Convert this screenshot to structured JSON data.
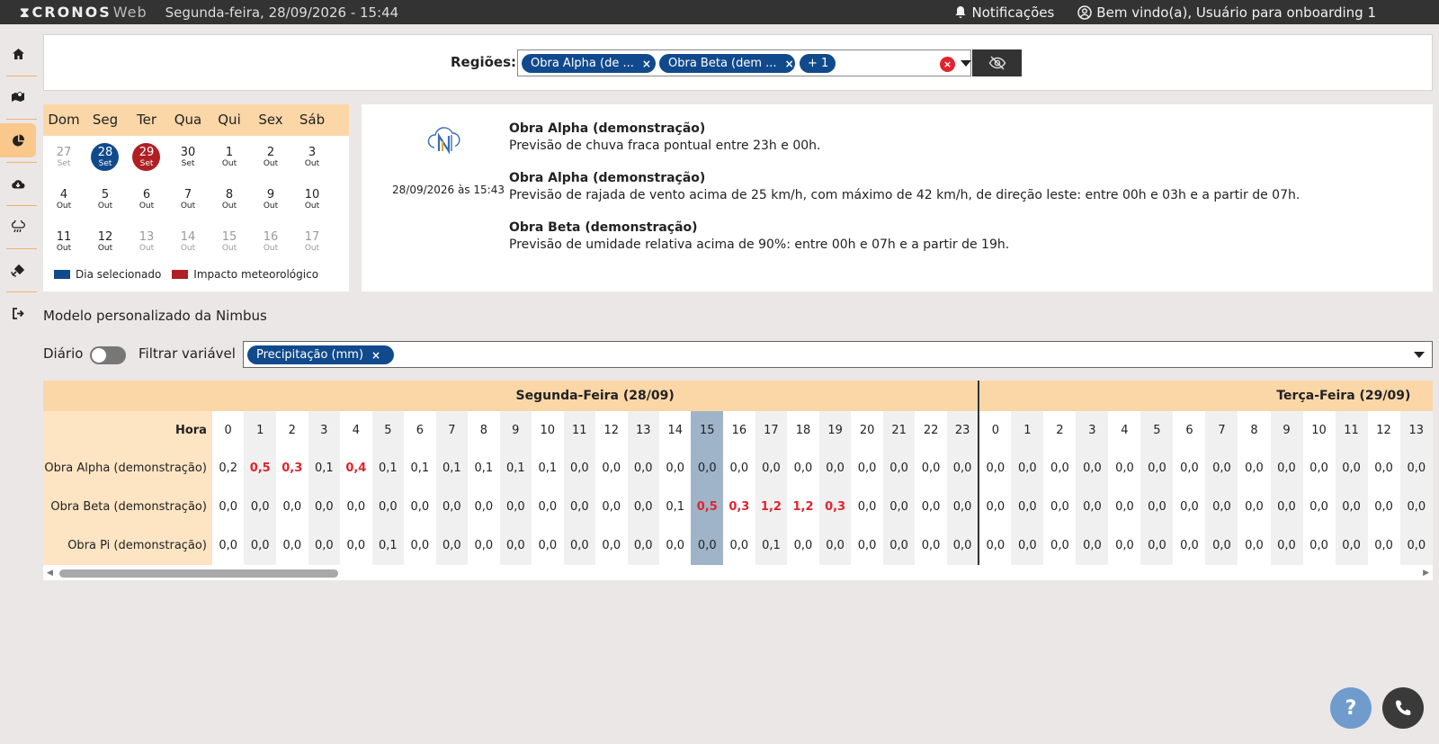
{
  "app": {
    "logo_main": "CRONOS",
    "logo_sub": "Web",
    "datetime": "Segunda-feira, 28/09/2026 - 15:44",
    "notifications": "Notificações",
    "welcome": "Bem vindo(a), Usuário para onboarding 1"
  },
  "sidebar": {
    "icons": [
      "home-icon",
      "map-icon",
      "pie-chart-icon",
      "cloud-download-icon",
      "cloud-rain-icon",
      "satellite-icon",
      "logout-icon"
    ]
  },
  "regions": {
    "label": "Regiões:",
    "chips": [
      "Obra Alpha (de ...",
      "Obra Beta (dem ...",
      "+ 1"
    ],
    "chip_close": "×",
    "clear": "×"
  },
  "calendar": {
    "weekdays": [
      "Dom",
      "Seg",
      "Ter",
      "Qua",
      "Qui",
      "Sex",
      "Sáb"
    ],
    "weeks": [
      [
        {
          "d": "27",
          "m": "Set",
          "s": "muted"
        },
        {
          "d": "28",
          "m": "Set",
          "s": "sel"
        },
        {
          "d": "29",
          "m": "Set",
          "s": "imp"
        },
        {
          "d": "30",
          "m": "Set",
          "s": ""
        },
        {
          "d": "1",
          "m": "Out",
          "s": ""
        },
        {
          "d": "2",
          "m": "Out",
          "s": ""
        },
        {
          "d": "3",
          "m": "Out",
          "s": ""
        }
      ],
      [
        {
          "d": "4",
          "m": "Out",
          "s": ""
        },
        {
          "d": "5",
          "m": "Out",
          "s": ""
        },
        {
          "d": "6",
          "m": "Out",
          "s": ""
        },
        {
          "d": "7",
          "m": "Out",
          "s": ""
        },
        {
          "d": "8",
          "m": "Out",
          "s": ""
        },
        {
          "d": "9",
          "m": "Out",
          "s": ""
        },
        {
          "d": "10",
          "m": "Out",
          "s": ""
        }
      ],
      [
        {
          "d": "11",
          "m": "Out",
          "s": ""
        },
        {
          "d": "12",
          "m": "Out",
          "s": ""
        },
        {
          "d": "13",
          "m": "Out",
          "s": "muted"
        },
        {
          "d": "14",
          "m": "Out",
          "s": "muted"
        },
        {
          "d": "15",
          "m": "Out",
          "s": "muted"
        },
        {
          "d": "16",
          "m": "Out",
          "s": "muted"
        },
        {
          "d": "17",
          "m": "Out",
          "s": "muted"
        }
      ]
    ],
    "legend_selected": "Dia selecionado",
    "legend_impact": "Impacto meteorológico",
    "color_selected": "#114a8c",
    "color_impact": "#b01f24"
  },
  "alerts": {
    "timestamp": "28/09/2026 às 15:43",
    "items": [
      {
        "title": "Obra Alpha (demonstração)",
        "body": "Previsão de chuva fraca pontual entre 23h e 00h."
      },
      {
        "title": "Obra Alpha (demonstração)",
        "body": "Previsão de rajada de vento acima de 25 km/h, com máximo de 42 km/h, de direção leste: entre 00h e 03h e a partir de 07h."
      },
      {
        "title": "Obra Beta (demonstração)",
        "body": "Previsão de umidade relativa acima de 90%: entre 00h e 07h e a partir de 19h."
      }
    ]
  },
  "model": {
    "title": "Modelo personalizado da Nimbus",
    "daily_label": "Diário",
    "filter_label": "Filtrar variável",
    "filter_chip": "Precipitação (mm)",
    "chip_close": "×"
  },
  "table": {
    "day1": "Segunda-Feira (28/09)",
    "day2": "Terça-Feira (29/09)",
    "hour_label": "Hora",
    "hours_day1": [
      "0",
      "1",
      "2",
      "3",
      "4",
      "5",
      "6",
      "7",
      "8",
      "9",
      "10",
      "11",
      "12",
      "13",
      "14",
      "15",
      "16",
      "17",
      "18",
      "19",
      "20",
      "21",
      "22",
      "23"
    ],
    "hours_day2": [
      "0",
      "1",
      "2",
      "3",
      "4",
      "5",
      "6",
      "7",
      "8",
      "9",
      "10",
      "11",
      "12",
      "13"
    ],
    "highlight_hour_index": 15,
    "rows": [
      {
        "name": "Obra Alpha (demonstração)",
        "day1": [
          "0,2",
          "0,5",
          "0,3",
          "0,1",
          "0,4",
          "0,1",
          "0,1",
          "0,1",
          "0,1",
          "0,1",
          "0,1",
          "0,0",
          "0,0",
          "0,0",
          "0,0",
          "0,0",
          "0,0",
          "0,0",
          "0,0",
          "0,0",
          "0,0",
          "0,0",
          "0,0",
          "0,0"
        ],
        "day1_alert": [
          1,
          2,
          4
        ],
        "day2": [
          "0,0",
          "0,0",
          "0,0",
          "0,0",
          "0,0",
          "0,0",
          "0,0",
          "0,0",
          "0,0",
          "0,0",
          "0,0",
          "0,0",
          "0,0",
          "0,0"
        ]
      },
      {
        "name": "Obra Beta (demonstração)",
        "day1": [
          "0,0",
          "0,0",
          "0,0",
          "0,0",
          "0,0",
          "0,0",
          "0,0",
          "0,0",
          "0,0",
          "0,0",
          "0,0",
          "0,0",
          "0,0",
          "0,0",
          "0,1",
          "0,5",
          "0,3",
          "1,2",
          "1,2",
          "0,3",
          "0,0",
          "0,0",
          "0,0",
          "0,0"
        ],
        "day1_alert": [
          15,
          16,
          17,
          18,
          19
        ],
        "day2": [
          "0,0",
          "0,0",
          "0,0",
          "0,0",
          "0,0",
          "0,0",
          "0,0",
          "0,0",
          "0,0",
          "0,0",
          "0,0",
          "0,0",
          "0,0",
          "0,0"
        ]
      },
      {
        "name": "Obra Pi (demonstração)",
        "day1": [
          "0,0",
          "0,0",
          "0,0",
          "0,0",
          "0,0",
          "0,1",
          "0,0",
          "0,0",
          "0,0",
          "0,0",
          "0,0",
          "0,0",
          "0,0",
          "0,0",
          "0,0",
          "0,0",
          "0,0",
          "0,1",
          "0,0",
          "0,0",
          "0,0",
          "0,0",
          "0,0",
          "0,0"
        ],
        "day1_alert": [],
        "day2": [
          "0,0",
          "0,0",
          "0,0",
          "0,0",
          "0,0",
          "0,0",
          "0,0",
          "0,0",
          "0,0",
          "0,0",
          "0,0",
          "0,0",
          "0,0",
          "0,0"
        ]
      }
    ]
  },
  "fabs": {
    "help": "?"
  },
  "colors": {
    "topbar": "#333333",
    "accent": "#fbd7a8",
    "chip": "#114a8c",
    "alert_text": "#e0242f",
    "highlight_col": "#9fb4c9"
  }
}
